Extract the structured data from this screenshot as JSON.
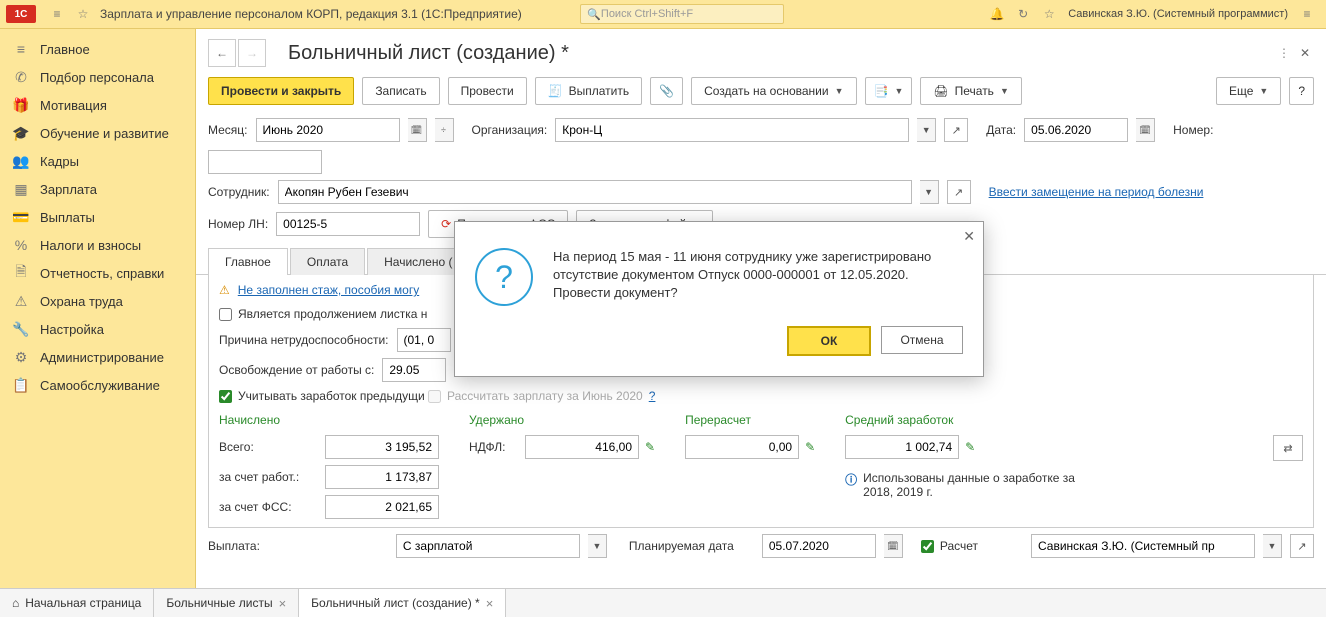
{
  "top": {
    "app_title": "Зарплата и управление персоналом КОРП, редакция 3.1  (1С:Предприятие)",
    "search_placeholder": "Поиск Ctrl+Shift+F",
    "user": "Савинская З.Ю. (Системный программист)"
  },
  "sidebar": {
    "items": [
      {
        "label": "Главное",
        "icon": "≡"
      },
      {
        "label": "Подбор персонала",
        "icon": "✆"
      },
      {
        "label": "Мотивация",
        "icon": "🎁"
      },
      {
        "label": "Обучение и развитие",
        "icon": "🎓"
      },
      {
        "label": "Кадры",
        "icon": "👥"
      },
      {
        "label": "Зарплата",
        "icon": "▦"
      },
      {
        "label": "Выплаты",
        "icon": "💳"
      },
      {
        "label": "Налоги и взносы",
        "icon": "%"
      },
      {
        "label": "Отчетность, справки",
        "icon": "🗎"
      },
      {
        "label": "Охрана труда",
        "icon": "⚠"
      },
      {
        "label": "Настройка",
        "icon": "🔧"
      },
      {
        "label": "Администрирование",
        "icon": "⚙"
      },
      {
        "label": "Самообслуживание",
        "icon": "📋"
      }
    ]
  },
  "doc": {
    "title": "Больничный лист (создание) *",
    "toolbar": {
      "post_close": "Провести и закрыть",
      "write": "Записать",
      "post": "Провести",
      "pay": "Выплатить",
      "create_based": "Создать на основании",
      "print": "Печать",
      "more": "Еще"
    },
    "fields": {
      "month_label": "Месяц:",
      "month": "Июнь 2020",
      "org_label": "Организация:",
      "org": "Крон-Ц",
      "date_label": "Дата:",
      "date": "05.06.2020",
      "number_label": "Номер:",
      "employee_label": "Сотрудник:",
      "employee": "Акопян Рубен Гезевич",
      "substitution_link": "Ввести замещение на период болезни",
      "ln_label": "Номер ЛН:",
      "ln": "00125-5",
      "get_fss": "Получить из ФСС",
      "load_file": "Загрузить из файла"
    },
    "tabs": {
      "main": "Главное",
      "payment": "Оплата",
      "accrued": "Начислено ("
    },
    "main_tab": {
      "warning": "Не заполнен стаж, пособия могу",
      "continuation": "Является продолжением листка н",
      "reason_label": "Причина нетрудоспособности:",
      "reason": "(01, 0",
      "off_label": "Освобождение от работы с:",
      "off_from": "29.05",
      "prev_earn": "Учитывать заработок предыдущи",
      "calc_label": "Рассчитать зарплату за Июнь 2020"
    },
    "totals": {
      "accrued": "Начислено",
      "withheld": "Удержано",
      "recalc": "Перерасчет",
      "avg": "Средний заработок",
      "total_label": "Всего:",
      "total": "3 195,52",
      "ndfl_label": "НДФЛ:",
      "ndfl": "416,00",
      "recalc_val": "0,00",
      "avg_val": "1 002,74",
      "employer_label": "за счет работ.:",
      "employer": "1 173,87",
      "fss_label": "за счет ФСС:",
      "fss": "2 021,65",
      "info": "Использованы данные о заработке за 2018,  2019 г."
    },
    "footer": {
      "payment_label": "Выплата:",
      "payment": "С зарплатой",
      "planned_label": "Планируемая дата",
      "planned": "05.07.2020",
      "calc_chk": "Расчет",
      "resp": "Савинская З.Ю. (Системный пр"
    }
  },
  "dialog": {
    "message": "На период 15 мая - 11 июня сотруднику уже зарегистрировано отсутствие документом Отпуск 0000-000001 от 12.05.2020. Провести документ?",
    "ok": "ОК",
    "cancel": "Отмена"
  },
  "bottom_tabs": {
    "home": "Начальная страница",
    "t1": "Больничные листы",
    "t2": "Больничный лист (создание) *"
  }
}
